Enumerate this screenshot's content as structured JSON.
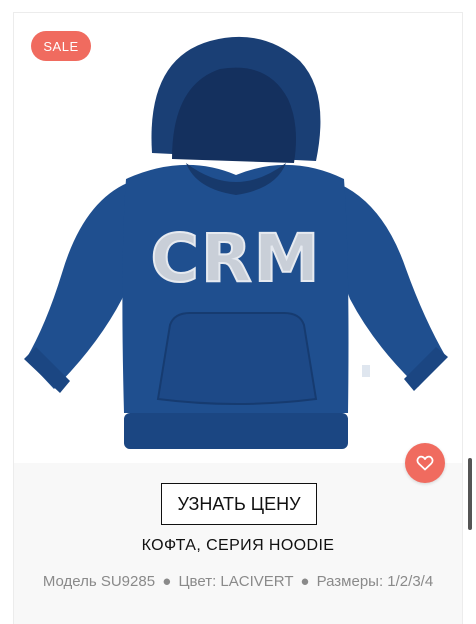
{
  "product_card": {
    "badge": "SALE",
    "image_icon": "hoodie-image",
    "favorite_icon": "heart-icon",
    "price_button_label": "УЗНАТЬ ЦЕНУ",
    "title": "КОФТА, СЕРИЯ HOODIE",
    "meta": {
      "model": "Модель SU9285",
      "color": "Цвет: LACIVERT",
      "sizes": "Размеры: 1/2/3/4",
      "separator": "●"
    },
    "print_text": "CRM"
  },
  "colors": {
    "accent": "#f06b5f",
    "hoodie": "#1f4f8f",
    "text": "#111111",
    "muted": "#8a8a8a"
  }
}
